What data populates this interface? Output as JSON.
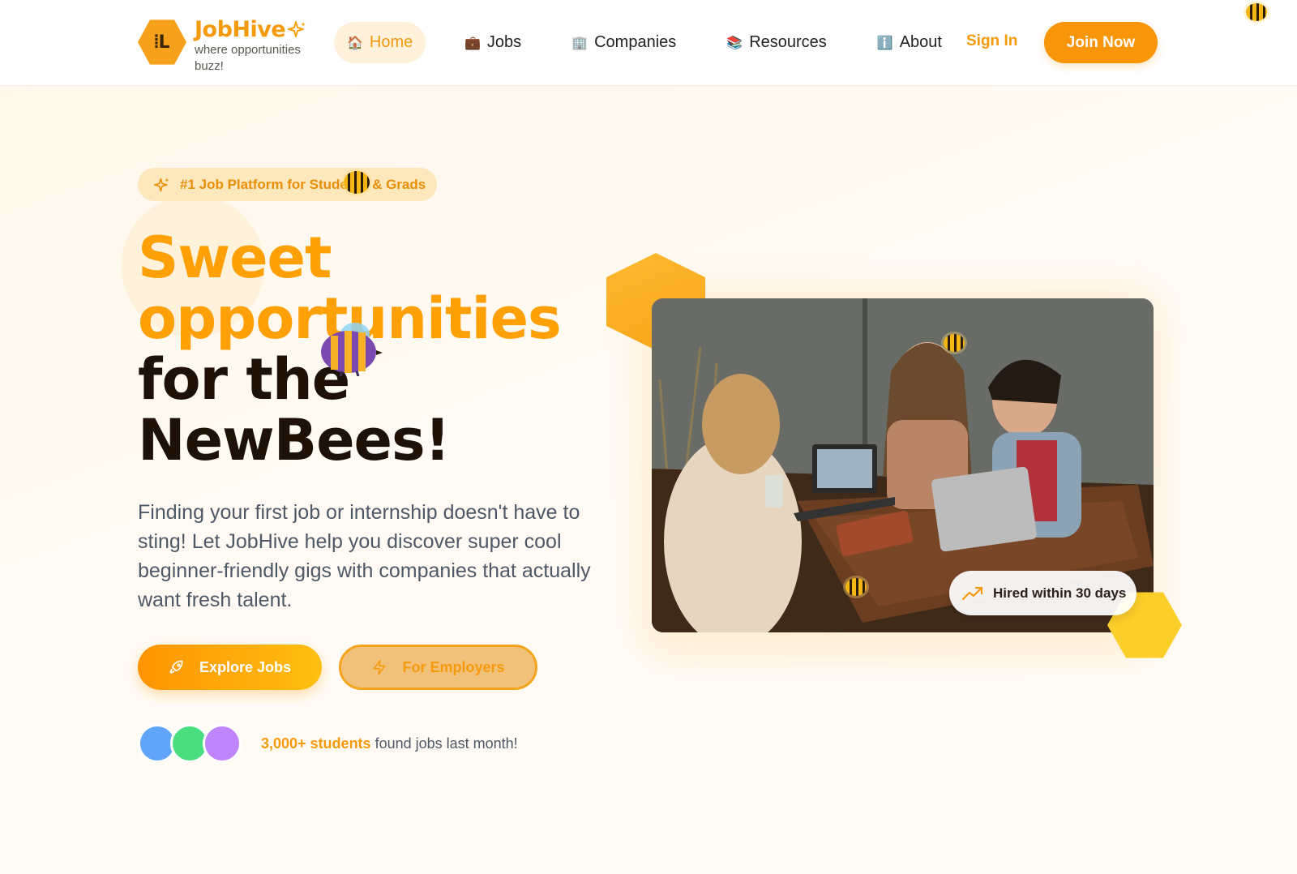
{
  "header": {
    "brand": "JobHive",
    "tagline": "where opportunities buzz!",
    "logo_glyph": "⦙L",
    "nav": [
      {
        "label": "Home",
        "emoji": "🏠",
        "active": true
      },
      {
        "label": "Jobs",
        "emoji": "💼",
        "active": false
      },
      {
        "label": "Companies",
        "emoji": "🏢",
        "active": false
      },
      {
        "label": "Resources",
        "emoji": "📚",
        "active": false
      },
      {
        "label": "About",
        "emoji": "ℹ️",
        "active": false
      }
    ],
    "sign_in": "Sign In",
    "join_now": "Join Now"
  },
  "hero": {
    "badge": "#1 Job Platform for Students & Grads",
    "headline": {
      "line1": "Sweet",
      "line2": "opportunities",
      "line3": "for the",
      "line4": "NewBees!"
    },
    "lead": "Finding your first job or internship doesn't have to sting! Let JobHive help you discover super cool beginner-friendly gigs with companies that actually want fresh talent.",
    "primary_button": "Explore Jobs",
    "secondary_button": "For Employers",
    "avatars": [
      {
        "color": "#60a5fa"
      },
      {
        "color": "#4ade80"
      },
      {
        "color": "#c084fc"
      }
    ],
    "social_proof_highlight": "3,000+ students",
    "social_proof_rest": " found jobs last month!",
    "hired_pill": "Hired within 30 days"
  },
  "colors": {
    "brand_orange": "#f59a0c",
    "headline_orange": "#ffa007",
    "headline_dark": "#1e1208",
    "hex_yellow": "#fcce2a"
  },
  "icons": [
    "sparkle-icon",
    "rocket-icon",
    "lightning-icon",
    "trending-up-icon",
    "bee-icon",
    "house-icon",
    "briefcase-icon",
    "building-icon",
    "books-icon",
    "info-icon"
  ]
}
